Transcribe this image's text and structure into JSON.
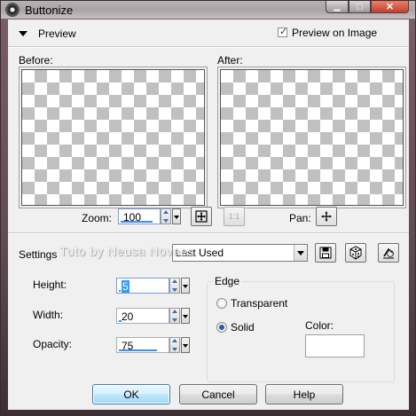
{
  "window": {
    "title": "Buttonize",
    "buttons": {
      "minimize": "▁",
      "maximize": "□",
      "close": "✕"
    }
  },
  "preview": {
    "label": "Preview",
    "preview_on_image_label": "Preview on Image",
    "preview_on_image_checked": true,
    "before_label": "Before:",
    "after_label": "After:"
  },
  "zoom": {
    "label": "Zoom:",
    "value": "100",
    "pan_label": "Pan:"
  },
  "settings": {
    "label": "Settings",
    "preset_value": "Last Used"
  },
  "fields": {
    "height_label": "Height:",
    "height_value": "5",
    "width_label": "Width:",
    "width_value": "20",
    "opacity_label": "Opacity:",
    "opacity_value": "75"
  },
  "edge": {
    "group_label": "Edge",
    "transparent_label": "Transparent",
    "solid_label": "Solid",
    "selected": "Solid",
    "color_label": "Color:",
    "color_value": "#ffffff"
  },
  "footer": {
    "ok_label": "OK",
    "cancel_label": "Cancel",
    "help_label": "Help"
  },
  "watermark": "Tuto by Neusa Novaes",
  "colors": {
    "accent": "#3d8ee6",
    "titlebar": "#b8b2b4",
    "close_button": "#c4402b"
  }
}
